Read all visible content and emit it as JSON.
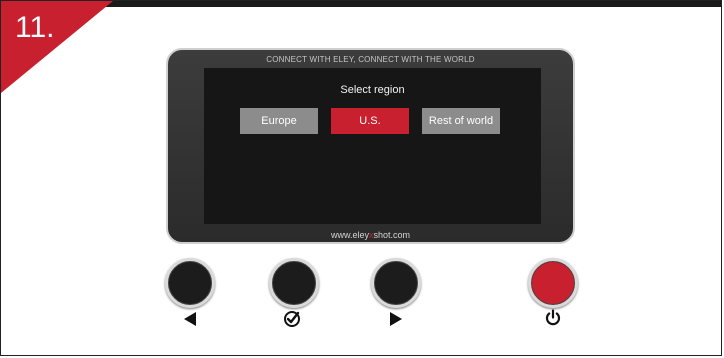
{
  "step": {
    "number": "11."
  },
  "device": {
    "tagline": "CONNECT WITH ELEY, CONNECT WITH THE WORLD",
    "screen_title": "Select region",
    "regions": [
      {
        "label": "Europe",
        "selected": false
      },
      {
        "label": "U.S.",
        "selected": true
      },
      {
        "label": "Rest of world",
        "selected": false
      }
    ],
    "url_prefix": "www.eley",
    "url_accent": "x",
    "url_suffix": "shot.com"
  },
  "buttons": [
    {
      "name": "left",
      "icon": "triangle-left-icon"
    },
    {
      "name": "ok",
      "icon": "checkmark-circle-icon"
    },
    {
      "name": "right",
      "icon": "triangle-right-icon"
    },
    {
      "name": "power",
      "icon": "power-icon"
    }
  ],
  "colors": {
    "accent": "#c8202f",
    "screen": "#161616",
    "unselected": "#8c8c8c"
  }
}
